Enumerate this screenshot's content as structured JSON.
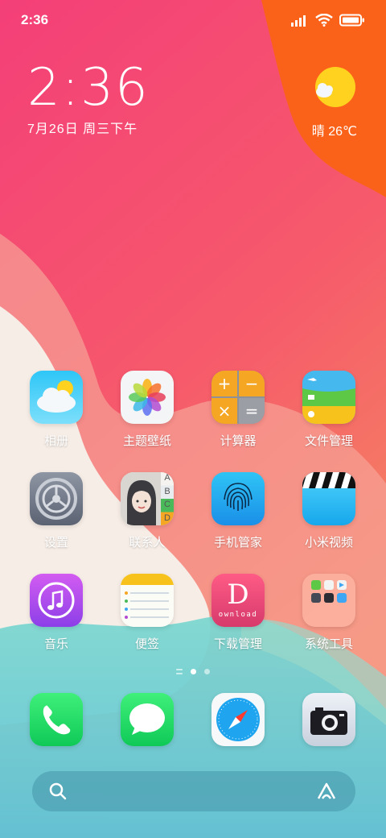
{
  "status_bar": {
    "time": "2:36"
  },
  "clock_widget": {
    "time": "2:36",
    "date": "7月26日 周三下午"
  },
  "weather_widget": {
    "text": "晴 26℃"
  },
  "apps": {
    "row1": [
      "相册",
      "主题壁纸",
      "计算器",
      "文件管理"
    ],
    "row2": [
      "设置",
      "联系人",
      "手机管家",
      "小米视频"
    ],
    "row3": [
      "音乐",
      "便签",
      "下载管理",
      "系统工具"
    ]
  },
  "download_icon": {
    "letter": "D",
    "word": "ownload"
  },
  "contacts_index": [
    "A",
    "B",
    "C",
    "D"
  ],
  "calculator_symbols": [
    "+",
    "−",
    "×",
    "="
  ],
  "colors": {
    "wall_pink": "#f5457a",
    "wall_orange": "#fb6a1c",
    "wall_teal": "#5fcfd3",
    "wall_cream": "#f7ede7"
  }
}
